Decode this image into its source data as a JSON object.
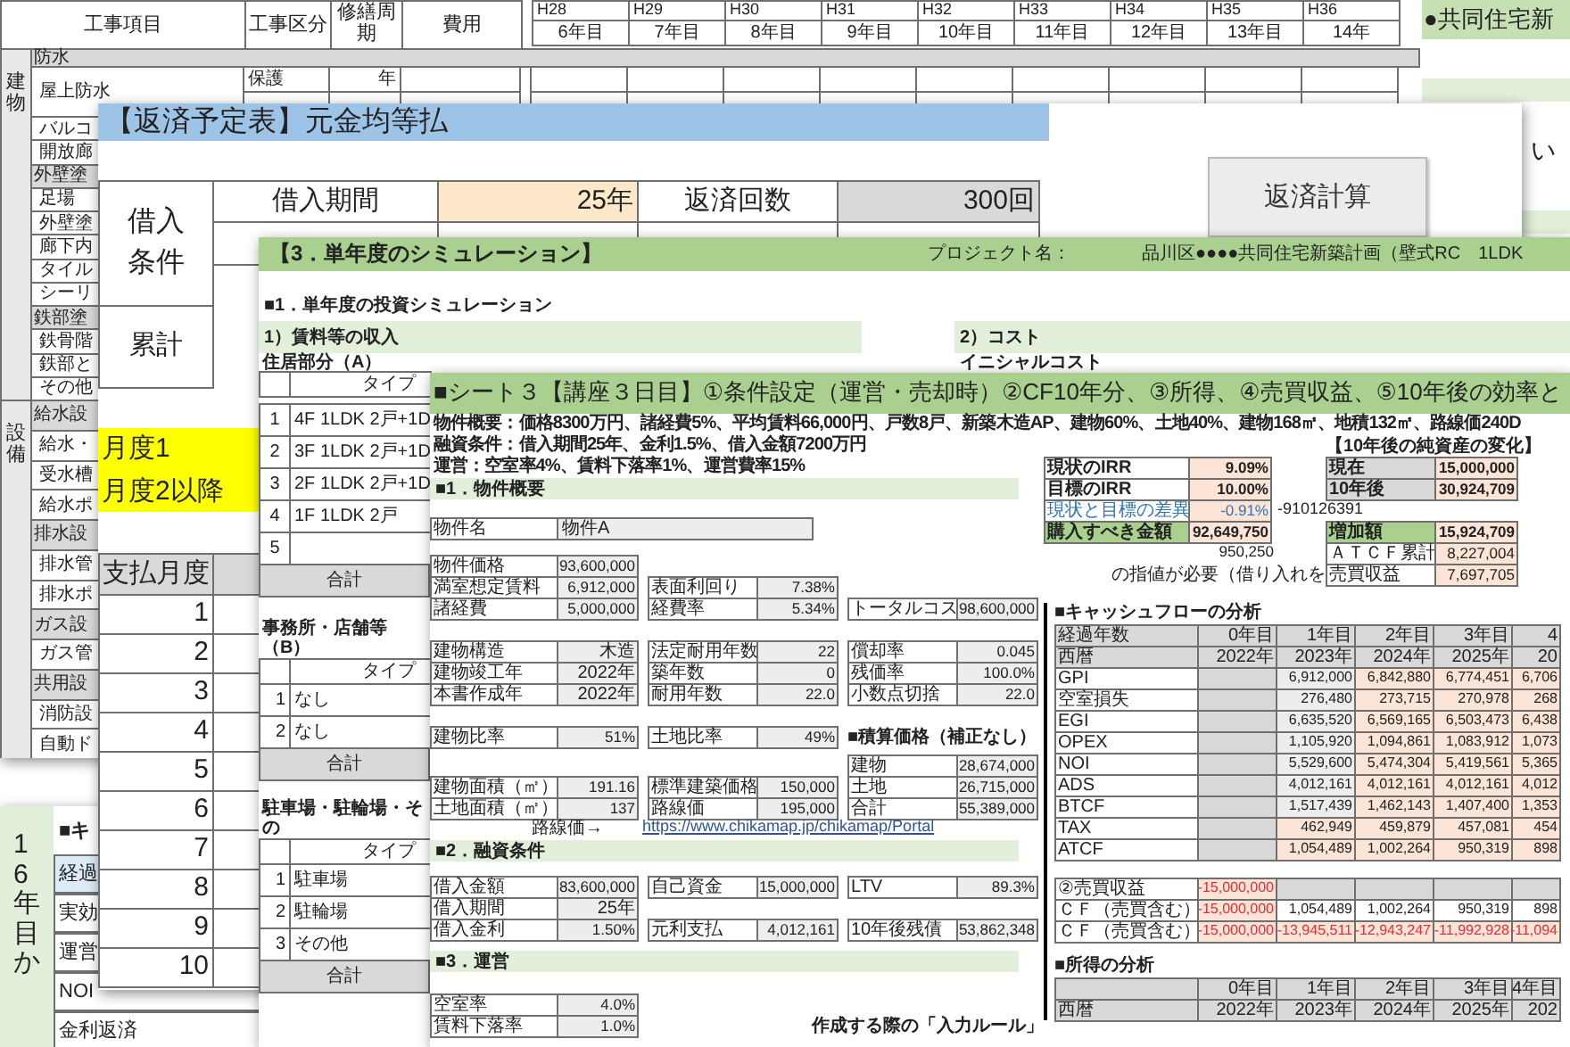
{
  "maintenance_sheet": {
    "header": {
      "item": "工事項目",
      "category": "工事区分",
      "cycle": "修繕周期",
      "cost": "費用"
    },
    "years": [
      {
        "era": "H28",
        "label": "6年目"
      },
      {
        "era": "H29",
        "label": "7年目"
      },
      {
        "era": "H30",
        "label": "8年目"
      },
      {
        "era": "H31",
        "label": "9年目"
      },
      {
        "era": "H32",
        "label": "10年目"
      },
      {
        "era": "H33",
        "label": "11年目"
      },
      {
        "era": "H34",
        "label": "12年目"
      },
      {
        "era": "H35",
        "label": "13年目"
      },
      {
        "era": "H36",
        "label": "14年"
      }
    ],
    "groups": [
      {
        "label": "建物",
        "rows": [
          {
            "kind": "section",
            "text": "防水"
          },
          {
            "kind": "item",
            "text": "屋上防水",
            "category": "保護",
            "cycle": "年"
          },
          {
            "kind": "item",
            "text": "バルコ"
          },
          {
            "kind": "item",
            "text": "開放廊"
          },
          {
            "kind": "section",
            "text": "外壁塗"
          },
          {
            "kind": "item",
            "text": "足場"
          },
          {
            "kind": "item",
            "text": "外壁塗"
          },
          {
            "kind": "item",
            "text": "廊下内"
          },
          {
            "kind": "item",
            "text": "タイル"
          },
          {
            "kind": "item",
            "text": "シーリ"
          },
          {
            "kind": "section",
            "text": "鉄部塗"
          },
          {
            "kind": "item",
            "text": "鉄骨階"
          },
          {
            "kind": "item",
            "text": "鉄部と"
          },
          {
            "kind": "item",
            "text": "その他"
          }
        ]
      },
      {
        "label": "設備",
        "rows": [
          {
            "kind": "section",
            "text": "給水設"
          },
          {
            "kind": "item",
            "text": "給水・"
          },
          {
            "kind": "item",
            "text": "受水槽"
          },
          {
            "kind": "item",
            "text": "給水ポ"
          },
          {
            "kind": "section",
            "text": "排水設"
          },
          {
            "kind": "item",
            "text": "排水管"
          },
          {
            "kind": "item",
            "text": "排水ポ"
          },
          {
            "kind": "section",
            "text": "ガス設"
          },
          {
            "kind": "item",
            "text": "ガス管"
          },
          {
            "kind": "section",
            "text": "共用設"
          },
          {
            "kind": "item",
            "text": "消防設"
          },
          {
            "kind": "item",
            "text": "自動ド"
          }
        ]
      }
    ]
  },
  "side_sheet": {
    "title": "●共同住宅新",
    "text": "い"
  },
  "lower_left_sheet": {
    "side_label": "16年目か",
    "heading": "■キ",
    "rows": [
      "経過",
      "実効",
      "運営",
      "NOI",
      "金利返済"
    ]
  },
  "loan_sheet": {
    "title": "【返済予定表】元金均等払",
    "conditions_label": "借入条件",
    "term_label": "借入期間",
    "term_value": "25年",
    "count_label": "返済回数",
    "count_value": "300回",
    "button": "返済計算",
    "cumulative_label": "累計",
    "notes": [
      "月度1",
      "月度2以降"
    ],
    "schedule_header": "支払月度",
    "months": [
      "1",
      "2",
      "3",
      "4",
      "5",
      "6",
      "7",
      "8",
      "9",
      "10"
    ]
  },
  "simulation_sheet": {
    "title": "【3．単年度のシミュレーション】",
    "project_label": "プロジェクト名：",
    "project_name": "品川区●●●●共同住宅新築計画（壁式RC　1LDK",
    "heading": "■1．単年度の投資シミュレーション",
    "income_band": "1）賃料等の収入",
    "cost_band": "2）コスト",
    "cost_subheading": "イニシャルコスト",
    "groups": [
      {
        "title": "住居部分（A）",
        "type_header": "タイプ",
        "rows": [
          {
            "no": "1",
            "type": "4F 1LDK 2戸+1D"
          },
          {
            "no": "2",
            "type": "3F 1LDK 2戸+1D"
          },
          {
            "no": "3",
            "type": "2F 1LDK 2戸+1D"
          },
          {
            "no": "4",
            "type": "1F 1LDK 2戸"
          },
          {
            "no": "5"
          }
        ],
        "total": "合計"
      },
      {
        "title": "事務所・店舗等（B）",
        "type_header": "タイプ",
        "rows": [
          {
            "no": "1",
            "type": "なし"
          },
          {
            "no": "2",
            "type": "なし"
          }
        ],
        "total": "合計"
      },
      {
        "title": "駐車場・駐輪場・その",
        "type_header": "タイプ",
        "rows": [
          {
            "no": "1",
            "type": "駐車場"
          },
          {
            "no": "2",
            "type": "駐輪場"
          },
          {
            "no": "3",
            "type": "その他"
          }
        ],
        "total": "合計"
      }
    ]
  },
  "course_sheet": {
    "title": "■シート３【講座３日目】①条件設定（運営・売却時）②CF10年分、③所得、④売買収益、⑤10年後の効率と",
    "summary": [
      "物件概要：価格8300万円、諸経費5%、平均賃料66,000円、戸数8戸、新築木造AP、建物60%、土地40%、建物168㎡、地積132㎡、路線価240D",
      "融資条件：借入期間25年、金利1.5%、借入金額7200万円",
      "運営：空室率4%、賃料下落率1%、運営費率15%"
    ],
    "property": {
      "heading": "■1．物件概要",
      "name_label": "物件名",
      "name_value": "物件A",
      "blocks": [
        [
          [
            {
              "kind": "pair",
              "label": "物件価格",
              "value": "93,600,000"
            },
            {
              "kind": "blank"
            },
            {
              "kind": "blank"
            }
          ],
          [
            {
              "kind": "pair",
              "label": "満室想定賃料",
              "value": "6,912,000"
            },
            {
              "kind": "pair",
              "label": "表面利回り",
              "value": "7.38%"
            },
            {
              "kind": "blank"
            }
          ],
          [
            {
              "kind": "pair",
              "label": "諸経費",
              "value": "5,000,000"
            },
            {
              "kind": "pair",
              "label": "経費率",
              "value": "5.34%"
            },
            {
              "kind": "pair",
              "label": "トータルコス",
              "value": "98,600,000"
            }
          ]
        ],
        [
          [
            {
              "kind": "pair",
              "label": "建物構造",
              "value": "木造"
            },
            {
              "kind": "pair",
              "label": "法定耐用年数",
              "value": "22"
            },
            {
              "kind": "pair",
              "label": "償却率",
              "value": "0.045"
            }
          ],
          [
            {
              "kind": "pair",
              "label": "建物竣工年",
              "value": "2022年"
            },
            {
              "kind": "pair",
              "label": "築年数",
              "value": "0"
            },
            {
              "kind": "pair",
              "label": "残価率",
              "value": "100.0%"
            }
          ],
          [
            {
              "kind": "pair",
              "label": "本書作成年",
              "value": "2022年"
            },
            {
              "kind": "pair",
              "label": "耐用年数",
              "value": "22.0"
            },
            {
              "kind": "pair",
              "label": "小数点切捨",
              "value": "22.0"
            }
          ]
        ],
        [
          [
            {
              "kind": "pair",
              "label": "建物比率",
              "value": "51%"
            },
            {
              "kind": "pair",
              "label": "土地比率",
              "value": "49%"
            },
            {
              "kind": "heading",
              "text": "■積算価格（補正なし）"
            }
          ]
        ],
        [
          [
            {
              "kind": "blank"
            },
            {
              "kind": "blank"
            },
            {
              "kind": "pair",
              "label": "建物",
              "value": "28,674,000"
            }
          ],
          [
            {
              "kind": "pair",
              "label": "建物面積（㎡）",
              "value": "191.16"
            },
            {
              "kind": "pair",
              "label": "標準建築価格",
              "value": "150,000"
            },
            {
              "kind": "pair",
              "label": "土地",
              "value": "26,715,000"
            }
          ],
          [
            {
              "kind": "pair",
              "label": "土地面積（㎡）",
              "value": "137"
            },
            {
              "kind": "pair",
              "label": "路線価",
              "value": "195,000"
            },
            {
              "kind": "pair",
              "label": "合計",
              "value": "55,389,000"
            }
          ]
        ]
      ]
    },
    "road_price_label": "路線価→",
    "road_price_link": "https://www.chikamap.jp/chikamap/Portal",
    "loan": {
      "heading": "■2．融資条件",
      "rows": [
        [
          {
            "kind": "pair",
            "label": "借入金額",
            "value": "83,600,000"
          },
          {
            "kind": "pair",
            "label": "自己資金",
            "value": "15,000,000"
          },
          {
            "kind": "pair",
            "label": "LTV",
            "value": "89.3%"
          }
        ],
        [
          {
            "kind": "pair",
            "label": "借入期間",
            "value": "25年"
          },
          {
            "kind": "blank"
          },
          {
            "kind": "blank"
          }
        ],
        [
          {
            "kind": "pair",
            "label": "借入金利",
            "value": "1.50%"
          },
          {
            "kind": "pair",
            "label": "元利支払",
            "value": "4,012,161"
          },
          {
            "kind": "pair",
            "label": "10年後残債",
            "value": "53,862,348"
          }
        ]
      ]
    },
    "operation": {
      "heading": "■3．運営",
      "rows": [
        [
          {
            "kind": "pair",
            "label": "空室率",
            "value": "4.0%"
          }
        ],
        [
          {
            "kind": "pair",
            "label": "賃料下落率",
            "value": "1.0%"
          }
        ]
      ],
      "note": "作成する際の「入力ルール」"
    },
    "irr": [
      {
        "kind": "normal",
        "label": "現状のIRR",
        "value": "9.09%"
      },
      {
        "kind": "normal",
        "label": "目標のIRR",
        "value": "10.00%"
      },
      {
        "kind": "note",
        "label": "現状と目標の差異",
        "value": "-0.91%",
        "aside": "-910126391"
      },
      {
        "kind": "highlight",
        "label": "購入すべき金額",
        "value": "92,649,750"
      }
    ],
    "price_gap": "950,250",
    "price_note": "の指値が必要（借り入れを",
    "net_assets": {
      "heading": "【10年後の純資産の変化】",
      "rows": [
        {
          "kind": "total",
          "label": "現在",
          "value": "15,000,000"
        },
        {
          "kind": "total",
          "label": "10年後",
          "value": "30,924,709"
        },
        {
          "kind": "highlight",
          "label": "増加額",
          "value": "15,924,709"
        },
        {
          "kind": "detail",
          "label": "ＡＴＣＦ累計",
          "value": "8,227,004"
        },
        {
          "kind": "detail",
          "label": "売買収益",
          "value": "7,697,705"
        }
      ]
    },
    "cashflow": {
      "heading": "■キャッシュフローの分析",
      "rows": [
        {
          "label": "経過年数",
          "cells": [
            "0年目",
            "1年目",
            "2年目",
            "3年目",
            "4"
          ]
        },
        {
          "label": "西暦",
          "cells": [
            "2022年",
            "2023年",
            "2024年",
            "2025年",
            "20"
          ]
        },
        {
          "label": "GPI",
          "cells": [
            null,
            "6,912,000",
            "6,842,880",
            "6,774,451",
            "6,706"
          ]
        },
        {
          "label": "空室損失",
          "cells": [
            null,
            "276,480",
            "273,715",
            "270,978",
            "268"
          ]
        },
        {
          "label": "EGI",
          "cells": [
            null,
            "6,635,520",
            "6,569,165",
            "6,503,473",
            "6,438"
          ]
        },
        {
          "label": "OPEX",
          "cells": [
            null,
            "1,105,920",
            "1,094,861",
            "1,083,912",
            "1,073"
          ]
        },
        {
          "label": "NOI",
          "cells": [
            null,
            "5,529,600",
            "5,474,304",
            "5,419,561",
            "5,365"
          ]
        },
        {
          "label": "ADS",
          "cells": [
            null,
            "4,012,161",
            "4,012,161",
            "4,012,161",
            "4,012"
          ]
        },
        {
          "label": "BTCF",
          "cells": [
            null,
            "1,517,439",
            "1,462,143",
            "1,407,400",
            "1,353"
          ]
        },
        {
          "label": "TAX",
          "cells": [
            null,
            "462,949",
            "459,879",
            "457,081",
            "454"
          ]
        },
        {
          "label": "ATCF",
          "cells": [
            null,
            "1,054,489",
            "1,002,264",
            "950,319",
            "898"
          ]
        }
      ]
    },
    "sale": {
      "rows": [
        {
          "label": "②売買収益",
          "cells": [
            "-15,000,000",
            null,
            null,
            null,
            null
          ]
        },
        {
          "label": "ＣＦ（売買含む）",
          "cells": [
            "-15,000,000",
            "1,054,489",
            "1,002,264",
            "950,319",
            "898"
          ]
        },
        {
          "label": "ＣＦ（売買含む）",
          "cells": [
            "-15,000,000",
            "-13,945,511",
            "-12,943,247",
            "-11,992,928",
            "-11,094"
          ]
        }
      ]
    },
    "income": {
      "heading": "■所得の分析",
      "rows": [
        {
          "cells": [
            "0年目",
            "1年目",
            "2年目",
            "3年目",
            "4年目"
          ]
        },
        {
          "label": "西暦",
          "cells": [
            "2022年",
            "2023年",
            "2024年",
            "2025年",
            "202"
          ]
        }
      ]
    }
  }
}
